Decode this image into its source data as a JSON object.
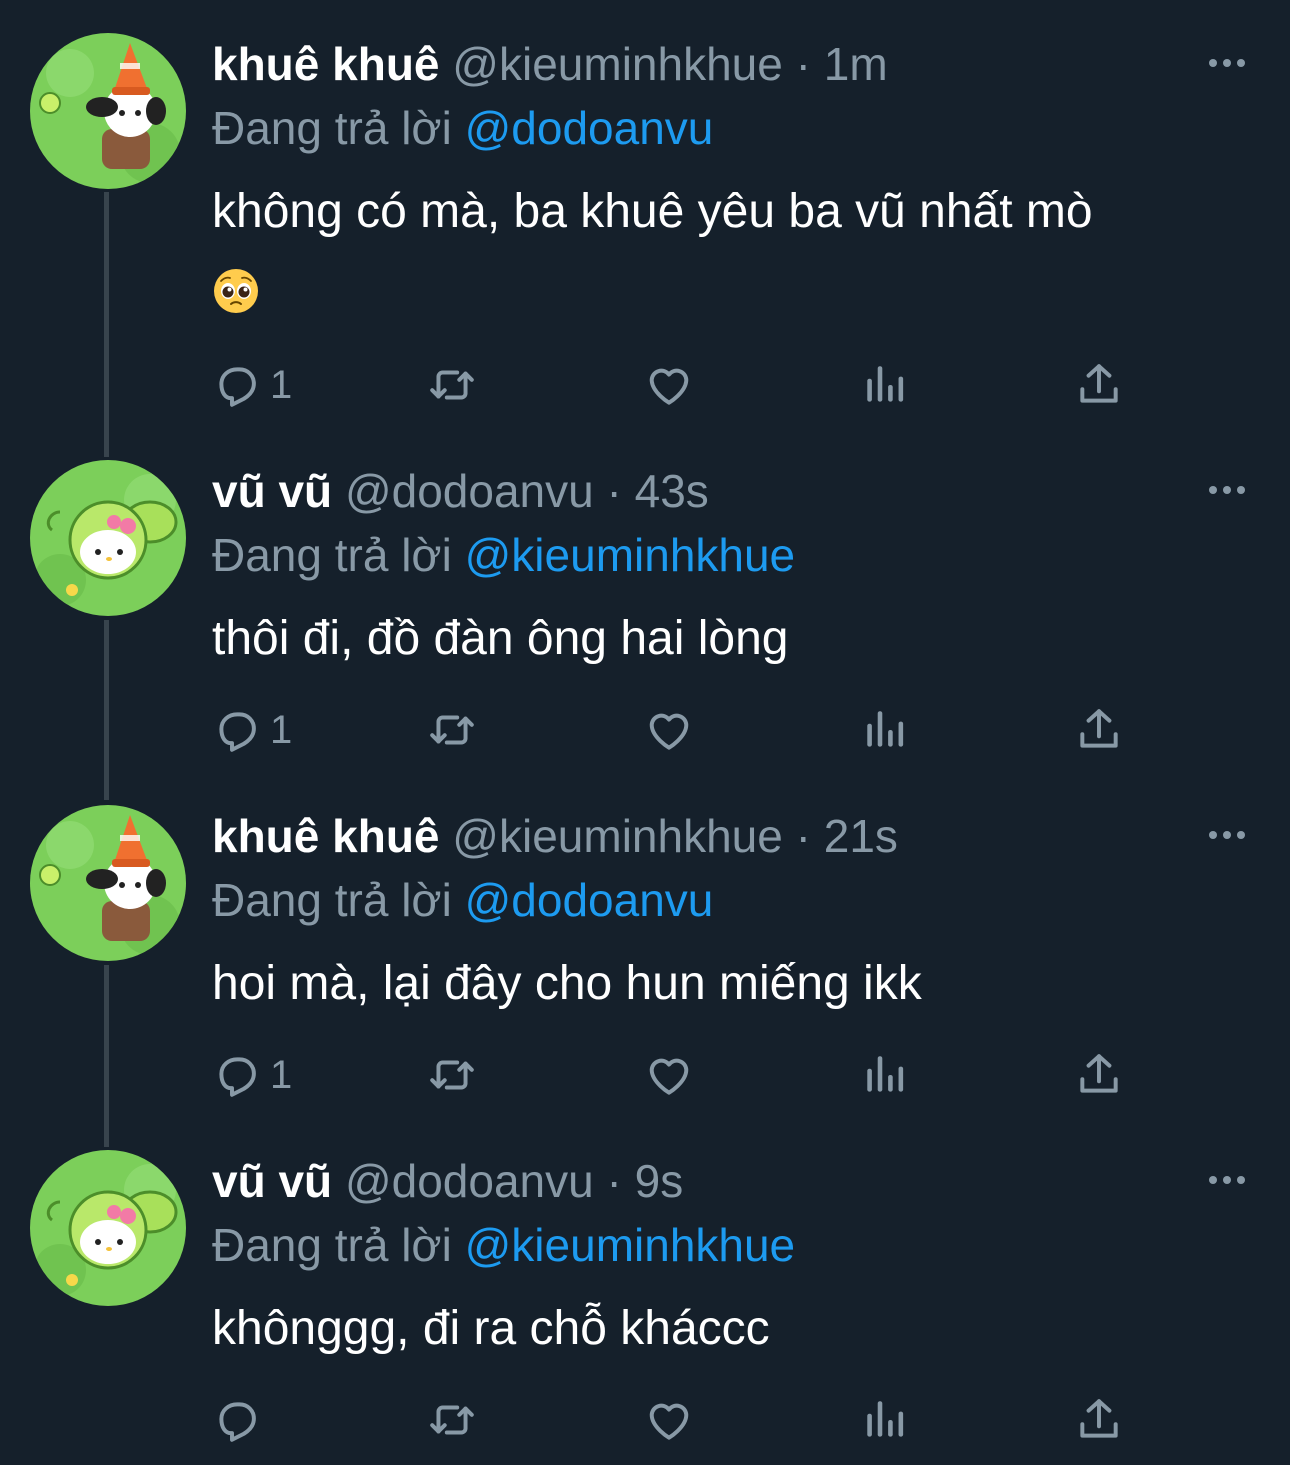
{
  "reply_prefix": "Đang trả lời",
  "tweets": [
    {
      "display_name": "khuê khuê",
      "handle": "@kieuminhkhue",
      "time": "1m",
      "reply_to": "@dodoanvu",
      "text": "không có mà, ba khuê yêu ba vũ nhất mò",
      "emoji": "pleading-face",
      "reply_count": "1"
    },
    {
      "display_name": "vũ vũ",
      "handle": "@dodoanvu",
      "time": "43s",
      "reply_to": "@kieuminhkhue",
      "text": "thôi đi, đồ đàn ông hai lòng",
      "reply_count": "1"
    },
    {
      "display_name": "khuê khuê",
      "handle": "@kieuminhkhue",
      "time": "21s",
      "reply_to": "@dodoanvu",
      "text": "hoi mà, lại đây cho hun miếng ikk",
      "reply_count": "1"
    },
    {
      "display_name": "vũ vũ",
      "handle": "@dodoanvu",
      "time": "9s",
      "reply_to": "@kieuminhkhue",
      "text": "khônggg, đi ra chỗ kháccc",
      "reply_count": ""
    }
  ],
  "colors": {
    "background": "#15202b",
    "secondary_text": "#8899a6",
    "mention": "#1d9bf0",
    "thread_line": "#38444d"
  },
  "icons": [
    "reply-icon",
    "retweet-icon",
    "like-icon",
    "views-icon",
    "share-icon",
    "more-icon"
  ]
}
